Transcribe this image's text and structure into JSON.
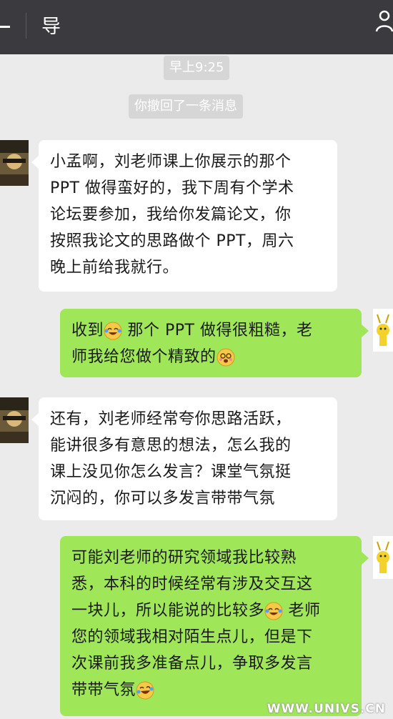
{
  "header": {
    "back_icon": "back-arrow-icon",
    "title": "导",
    "profile_icon": "person-icon"
  },
  "timestamp": "早上9:25",
  "system_notice": "你撤回了一条消息",
  "colors": {
    "header_bg": "#3a3a3f",
    "chat_bg": "#ebebeb",
    "incoming_bubble": "#ffffff",
    "outgoing_bubble": "#9fe658"
  },
  "messages": [
    {
      "side": "incoming",
      "lines": [
        "小孟啊，刘老师课上你展示的那个",
        "PPT 做得蛮好的，我下周有个学术",
        "论坛要参加，我给你发篇论文，你",
        "按照我论文的思路做个 PPT，周六",
        "晚上前给我就行。"
      ]
    },
    {
      "side": "outgoing",
      "line1_a": "收到",
      "line1_emoji": "laughing-tears-emoji",
      "line1_b": " 那个 PPT 做得很粗糙，老",
      "line2_a": "师我给您做个精致的",
      "line2_emoji": "dizzy-face-emoji"
    },
    {
      "side": "incoming",
      "lines": [
        "还有，刘老师经常夸你思路活跃，",
        "能讲很多有意思的想法，怎么我的",
        "课上没见你怎么发言？课堂气氛挺",
        "沉闷的，你可以多发言带带气氛"
      ]
    },
    {
      "side": "outgoing",
      "line1": "可能刘老师的研究领域我比较熟",
      "line2": "悉，本科的时候经常有涉及交互这",
      "line3_a": "一块儿，所以能说的比较多",
      "line3_emoji": "laughing-tears-emoji",
      "line3_b": " 老师",
      "line4": "您的领域我相对陌生点儿，但是下",
      "line5": "次课前我多准备点儿，争取多发言",
      "line6_a": "带带气氛",
      "line6_emoji": "crying-laughing-emoji"
    }
  ],
  "watermark": "WWW.UNIVS.CN"
}
